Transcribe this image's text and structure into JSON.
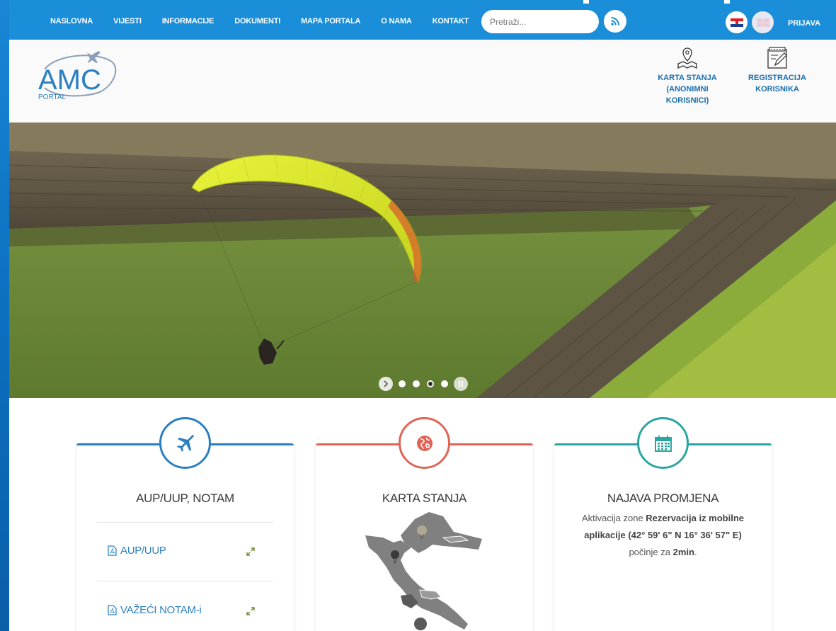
{
  "nav": {
    "items": [
      "NASLOVNA",
      "VIJESTI",
      "INFORMACIJE",
      "DOKUMENTI",
      "MAPA PORTALA",
      "O NAMA",
      "KONTAKT"
    ],
    "search_placeholder": "Pretraži...",
    "login": "PRIJAVA"
  },
  "header": {
    "logo_text": "AMC",
    "logo_sub": "PORTAL",
    "links": [
      {
        "label": "KARTA STANJA (ANONIMNI KORISNICI)",
        "icon": "map-pin-icon"
      },
      {
        "label": "REGISTRACIJA KORISNIKA",
        "icon": "edit-form-icon"
      }
    ]
  },
  "carousel": {
    "slides": 4,
    "active_index": 2
  },
  "cards": [
    {
      "title": "AUP/UUP, NOTAM",
      "icon": "plane-icon",
      "color": "#2a7fc0",
      "links": [
        "AUP/UUP",
        "VAŽEĆI NOTAM-i"
      ]
    },
    {
      "title": "KARTA STANJA",
      "icon": "globe-icon",
      "color": "#e06456"
    },
    {
      "title": "NAJAVA PROMJENA",
      "icon": "calendar-icon",
      "color": "#2aa6a0",
      "text_prefix": "Aktivacija zone ",
      "text_bold": "Rezervacija iz mobilne aplikacije (42° 59' 6\" N 16° 36' 57\" E)",
      "text_mid": " počinje za ",
      "text_bold2": "2min",
      "text_suffix": "."
    }
  ]
}
